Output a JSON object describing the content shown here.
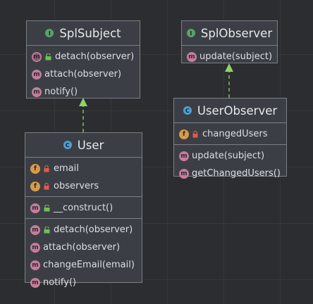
{
  "classes": {
    "splsubject": {
      "name": "SplSubject",
      "kind_icon": "interface-icon",
      "kind_letter": "I",
      "methods": [
        {
          "label": "detach(observer)",
          "icon": "method-override-icon",
          "access": "public-unlocked-icon"
        },
        {
          "label": "attach(observer)",
          "icon": "method-icon"
        },
        {
          "label": "notify()",
          "icon": "method-icon"
        }
      ]
    },
    "splobserver": {
      "name": "SplObserver",
      "kind_icon": "interface-icon",
      "kind_letter": "I",
      "methods": [
        {
          "label": "update(subject)",
          "icon": "method-icon"
        }
      ]
    },
    "userobserver": {
      "name": "UserObserver",
      "kind_icon": "class-icon",
      "kind_letter": "C",
      "fields": [
        {
          "label": "changedUsers",
          "icon": "field-icon",
          "access": "private-lock-icon"
        }
      ],
      "methods": [
        {
          "label": "update(subject)",
          "icon": "method-icon"
        },
        {
          "label": "getChangedUsers()",
          "icon": "method-icon"
        }
      ]
    },
    "user": {
      "name": "User",
      "kind_icon": "class-icon",
      "kind_letter": "C",
      "fields": [
        {
          "label": "email",
          "icon": "field-icon",
          "access": "private-lock-icon"
        },
        {
          "label": "observers",
          "icon": "field-icon",
          "access": "private-lock-icon"
        }
      ],
      "constructors": [
        {
          "label": "__construct()",
          "icon": "method-icon",
          "access": "public-unlocked-icon"
        }
      ],
      "methods": [
        {
          "label": "detach(observer)",
          "icon": "method-icon",
          "access": "public-unlocked-icon"
        },
        {
          "label": "attach(observer)",
          "icon": "method-icon"
        },
        {
          "label": "changeEmail(email)",
          "icon": "method-icon"
        },
        {
          "label": "notify()",
          "icon": "method-icon"
        }
      ]
    }
  },
  "relations": [
    {
      "from": "User",
      "to": "SplSubject",
      "type": "implements"
    },
    {
      "from": "UserObserver",
      "to": "SplObserver",
      "type": "implements"
    }
  ],
  "colors": {
    "background": "#2b2d30",
    "box": "#3b3f45",
    "border": "#7b7f86",
    "arrow": "#8fd36a",
    "interface_icon": "#5aa06a",
    "class_icon": "#4d9fd6",
    "method_icon": "#c77c9b",
    "field_icon": "#d79a47"
  }
}
